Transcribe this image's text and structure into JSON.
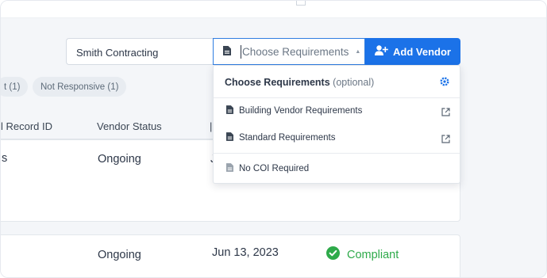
{
  "search": {
    "vendor_value": "Smith Contracting"
  },
  "requirements_select": {
    "placeholder": "Choose Requirements"
  },
  "add_vendor": {
    "label": "Add Vendor"
  },
  "filters": [
    {
      "label": "t (1)"
    },
    {
      "label": "Not Responsive (1)"
    }
  ],
  "table": {
    "headers": {
      "record_id": "l Record ID",
      "status": "Vendor Status"
    },
    "rows": [
      {
        "record_id": "s",
        "status": "Ongoing",
        "date": "",
        "compliance": ""
      },
      {
        "record_id": "",
        "status": "Ongoing",
        "date": "Jun 13, 2023",
        "compliance": "Compliant"
      }
    ]
  },
  "dropdown": {
    "heading": "Choose Requirements",
    "heading_note": "(optional)",
    "items": [
      {
        "label": "Building Vendor Requirements",
        "external": true
      },
      {
        "label": "Standard Requirements",
        "external": true
      },
      {
        "label": "No COI Required",
        "external": false
      }
    ]
  },
  "colors": {
    "accent": "#1b72e8",
    "focus_border": "#2f7de1",
    "compliant": "#2eaa4a",
    "chip_bg": "#e8ecf1"
  },
  "icons": [
    "document-icon",
    "add-user-icon",
    "gear-icon",
    "external-link-icon",
    "check-circle-icon",
    "caret-up-icon"
  ]
}
